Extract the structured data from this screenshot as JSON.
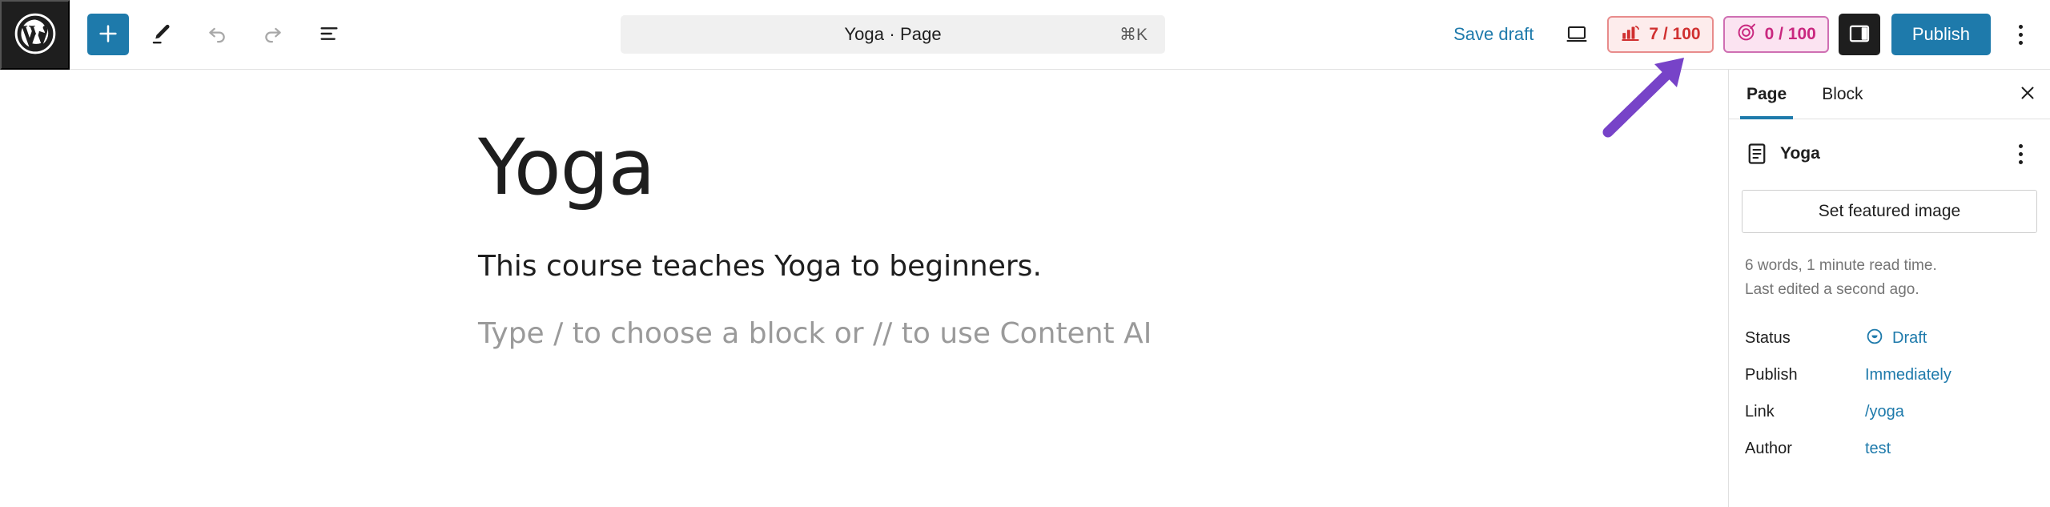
{
  "app": {
    "logo_icon": "wordpress-logo-icon"
  },
  "toolbar": {
    "add_block_icon": "plus-icon",
    "tools_icon": "pencil-icon",
    "undo_icon": "undo-arrow-icon",
    "redo_icon": "redo-arrow-icon",
    "document_overview_icon": "list-view-icon"
  },
  "command_bar": {
    "title": "Yoga · Page",
    "shortcut": "⌘K"
  },
  "header_actions": {
    "save_draft_label": "Save draft",
    "view_icon": "desktop-device-icon",
    "seo_badge": {
      "icon": "seo-score-icon",
      "score": "7 / 100",
      "color": "#d03030",
      "background": "#fdecec",
      "border": "#e88c8c"
    },
    "content_ai_badge": {
      "icon": "content-ai-target-icon",
      "score": "0 / 100",
      "color": "#c9277f",
      "background": "#fbe3f1",
      "border": "#cf6fb3"
    },
    "panel_toggle_icon": "sidebar-panel-icon",
    "publish_label": "Publish",
    "more_icon": "vertical-ellipsis-icon"
  },
  "editor": {
    "title": "Yoga",
    "paragraph": "This course teaches Yoga to beginners.",
    "placeholder": "Type / to choose a block or // to use Content AI"
  },
  "sidebar": {
    "tabs": [
      {
        "label": "Page",
        "active": true
      },
      {
        "label": "Block",
        "active": false
      }
    ],
    "close_icon": "close-x-icon",
    "document": {
      "icon": "page-document-icon",
      "name": "Yoga",
      "more_icon": "vertical-ellipsis-icon"
    },
    "featured_image_label": "Set featured image",
    "meta": {
      "word_count": "6 words, 1 minute read time.",
      "last_edited": "Last edited a second ago."
    },
    "rows": [
      {
        "label": "Status",
        "value": "Draft",
        "icon": "status-draft-icon"
      },
      {
        "label": "Publish",
        "value": "Immediately",
        "icon": ""
      },
      {
        "label": "Link",
        "value": "/yoga",
        "icon": ""
      },
      {
        "label": "Author",
        "value": "test",
        "icon": ""
      }
    ]
  },
  "annotation": {
    "arrow_color": "#7743c8",
    "arrow_target": "seo-score-badge"
  }
}
